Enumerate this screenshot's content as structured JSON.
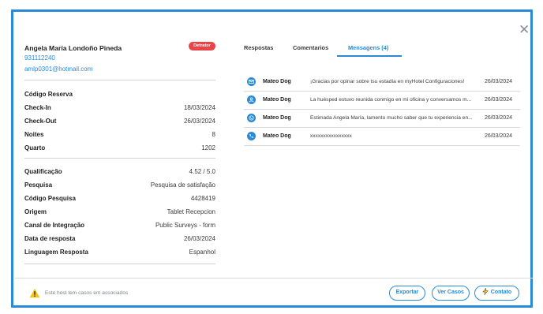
{
  "guest": {
    "name": "Angela María Londoño Pineda",
    "badge": "Detrator",
    "phone": "931112240",
    "email": "amlp0301@hotmail.com"
  },
  "reservation": [
    {
      "label": "Código Reserva",
      "value": ""
    },
    {
      "label": "Check-In",
      "value": "18/03/2024"
    },
    {
      "label": "Check-Out",
      "value": "26/03/2024"
    },
    {
      "label": "Noites",
      "value": "8"
    },
    {
      "label": "Quarto",
      "value": "1202"
    }
  ],
  "survey": [
    {
      "label": "Qualificação",
      "value": "4.52 / 5.0"
    },
    {
      "label": "Pesquisa",
      "value": "Pesquisa de satisfação"
    },
    {
      "label": "Código Pesquisa",
      "value": "4428419"
    },
    {
      "label": "Origem",
      "value": "Tablet Recepcion"
    },
    {
      "label": "Canal de Integração",
      "value": "Public Surveys - form"
    },
    {
      "label": "Data de resposta",
      "value": "26/03/2024"
    },
    {
      "label": "Linguagem Resposta",
      "value": "Espanhol"
    }
  ],
  "tabs": [
    {
      "label": "Respostas",
      "active": false
    },
    {
      "label": "Comentarios",
      "active": false
    },
    {
      "label": "Mensagens (4)",
      "active": true
    }
  ],
  "messages": [
    {
      "icon": "email-icon",
      "author": "Mateo Dog",
      "text": "¡Gracias por opinar sobre tsu estadía en myHotel Configuraciones!",
      "date": "26/03/2024"
    },
    {
      "icon": "user-icon",
      "author": "Mateo Dog",
      "text": "La huésped estuvo reunida conmigo en mi oficina y conversamos m...",
      "date": "26/03/2024"
    },
    {
      "icon": "whatsapp-icon",
      "author": "Mateo Dog",
      "text": "Estimada Angela María, lamento mucho saber que tu experiencia en...",
      "date": "26/03/2024"
    },
    {
      "icon": "phone-icon",
      "author": "Mateo Dog",
      "text": "xxxxxxxxxxxxxxxx",
      "date": "26/03/2024"
    }
  ],
  "footer": {
    "warning": "Este host tem casos em associados",
    "buttons": {
      "export": "Exportar",
      "view_cases": "Ver Casos",
      "contact": "Contato"
    }
  },
  "colors": {
    "accent": "#2a8ad8",
    "badge": "#e8454a",
    "warning": "#f5c518"
  }
}
